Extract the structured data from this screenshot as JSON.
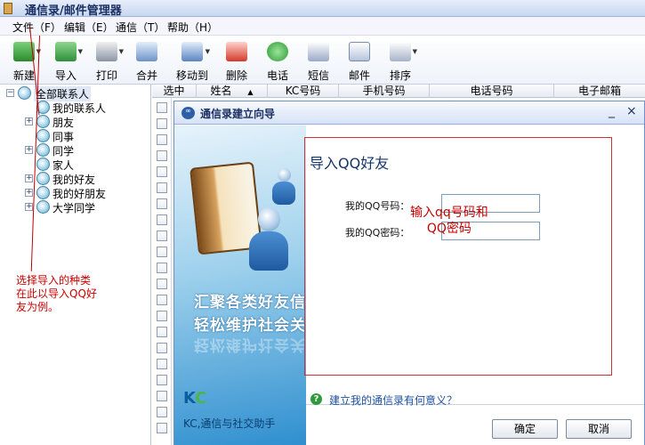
{
  "window": {
    "title": "通信录/邮件管理器"
  },
  "menu": [
    {
      "label": "文件（F）"
    },
    {
      "label": "编辑（E）"
    },
    {
      "label": "通信（T）"
    },
    {
      "label": "帮助（H）"
    }
  ],
  "toolbar": [
    {
      "label": "新建",
      "icon": "new-contact-icon"
    },
    {
      "label": "导入",
      "icon": "import-icon"
    },
    {
      "label": "打印",
      "icon": "printer-icon"
    },
    {
      "label": "合并",
      "icon": "merge-icon"
    },
    {
      "label": "移动到",
      "icon": "move-to-icon"
    },
    {
      "label": "删除",
      "icon": "delete-icon"
    },
    {
      "label": "电话",
      "icon": "phone-icon"
    },
    {
      "label": "短信",
      "icon": "sms-icon"
    },
    {
      "label": "邮件",
      "icon": "mail-icon"
    },
    {
      "label": "排序",
      "icon": "sort-icon"
    }
  ],
  "tree": {
    "root": "全部联系人",
    "groups": [
      "我的联系人",
      "朋友",
      "同事",
      "同学",
      "家人",
      "我的好友",
      "我的好朋友",
      "大学同学"
    ]
  },
  "annotations": {
    "tree_note": "选择导入的种类\n在此以导入QQ好\n友为例。"
  },
  "table": {
    "columns": [
      "选中",
      "姓名",
      "KC号码",
      "手机号码",
      "电话号码",
      "电子邮箱"
    ],
    "sort_indicator": "▲"
  },
  "dialog": {
    "title": "通信录建立向导",
    "minimize": "_",
    "close": "×",
    "slogan_line1": "汇聚各类好友信息",
    "slogan_line2": "轻松维护社会关系",
    "logo_k": "K",
    "logo_c": "C",
    "tagline": "KC,通信与社交助手",
    "heading": "导入QQ好友",
    "qq_number_label": "我的QQ号码：",
    "qq_password_label": "我的QQ密码：",
    "qq_number_value": "",
    "qq_password_value": "",
    "field_note": "输入qq号码和\nQQ密码",
    "help_icon": "?",
    "help_link": "建立我的通信录有何意义？",
    "ok_button": "确定",
    "cancel_button": "取消"
  }
}
